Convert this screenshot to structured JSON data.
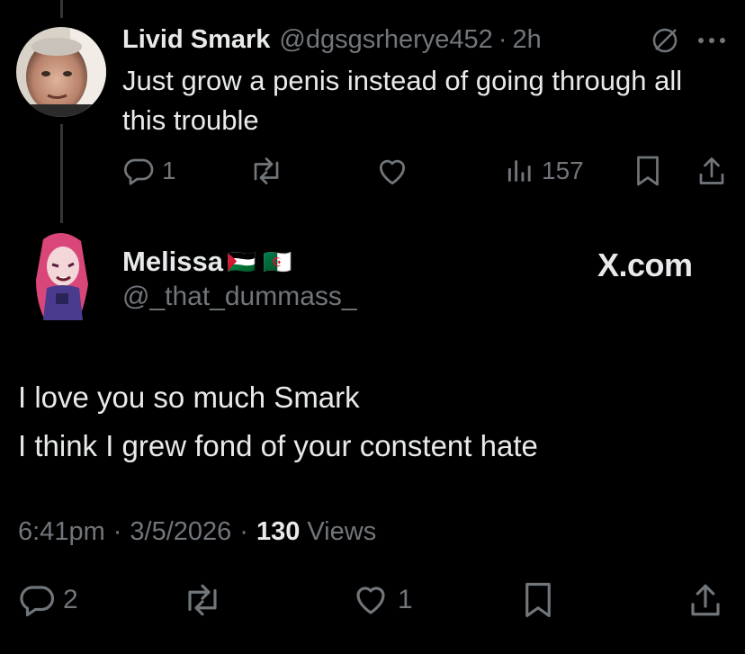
{
  "reply": {
    "author_name": "Livid Smark",
    "handle": "@dgsgsrherye452",
    "separator": "·",
    "time": "2h",
    "text": "Just grow a penis instead of going through all this trouble",
    "replies": "1",
    "views": "157",
    "icons": [
      "block-icon",
      "more-icon",
      "reply-icon",
      "retweet-icon",
      "like-icon",
      "views-icon",
      "bookmark-icon",
      "share-icon"
    ]
  },
  "main": {
    "author_name": "Melissa",
    "flags": [
      "🇵🇸",
      "🇩🇿"
    ],
    "handle": "@_that_dummass_",
    "watermark": "X.com",
    "text_line1": "I love you so much Smark",
    "text_line2": "I think I grew fond of your constent hate",
    "time": "6:41pm",
    "sep1": "·",
    "date": "3/5/2026",
    "sep2": "·",
    "views_count": "130",
    "views_label": "Views",
    "replies": "2",
    "likes": "1"
  },
  "colors": {
    "background": "#000000",
    "text": "#e7e9ea",
    "muted": "#71767b",
    "thread_line": "#333639"
  }
}
